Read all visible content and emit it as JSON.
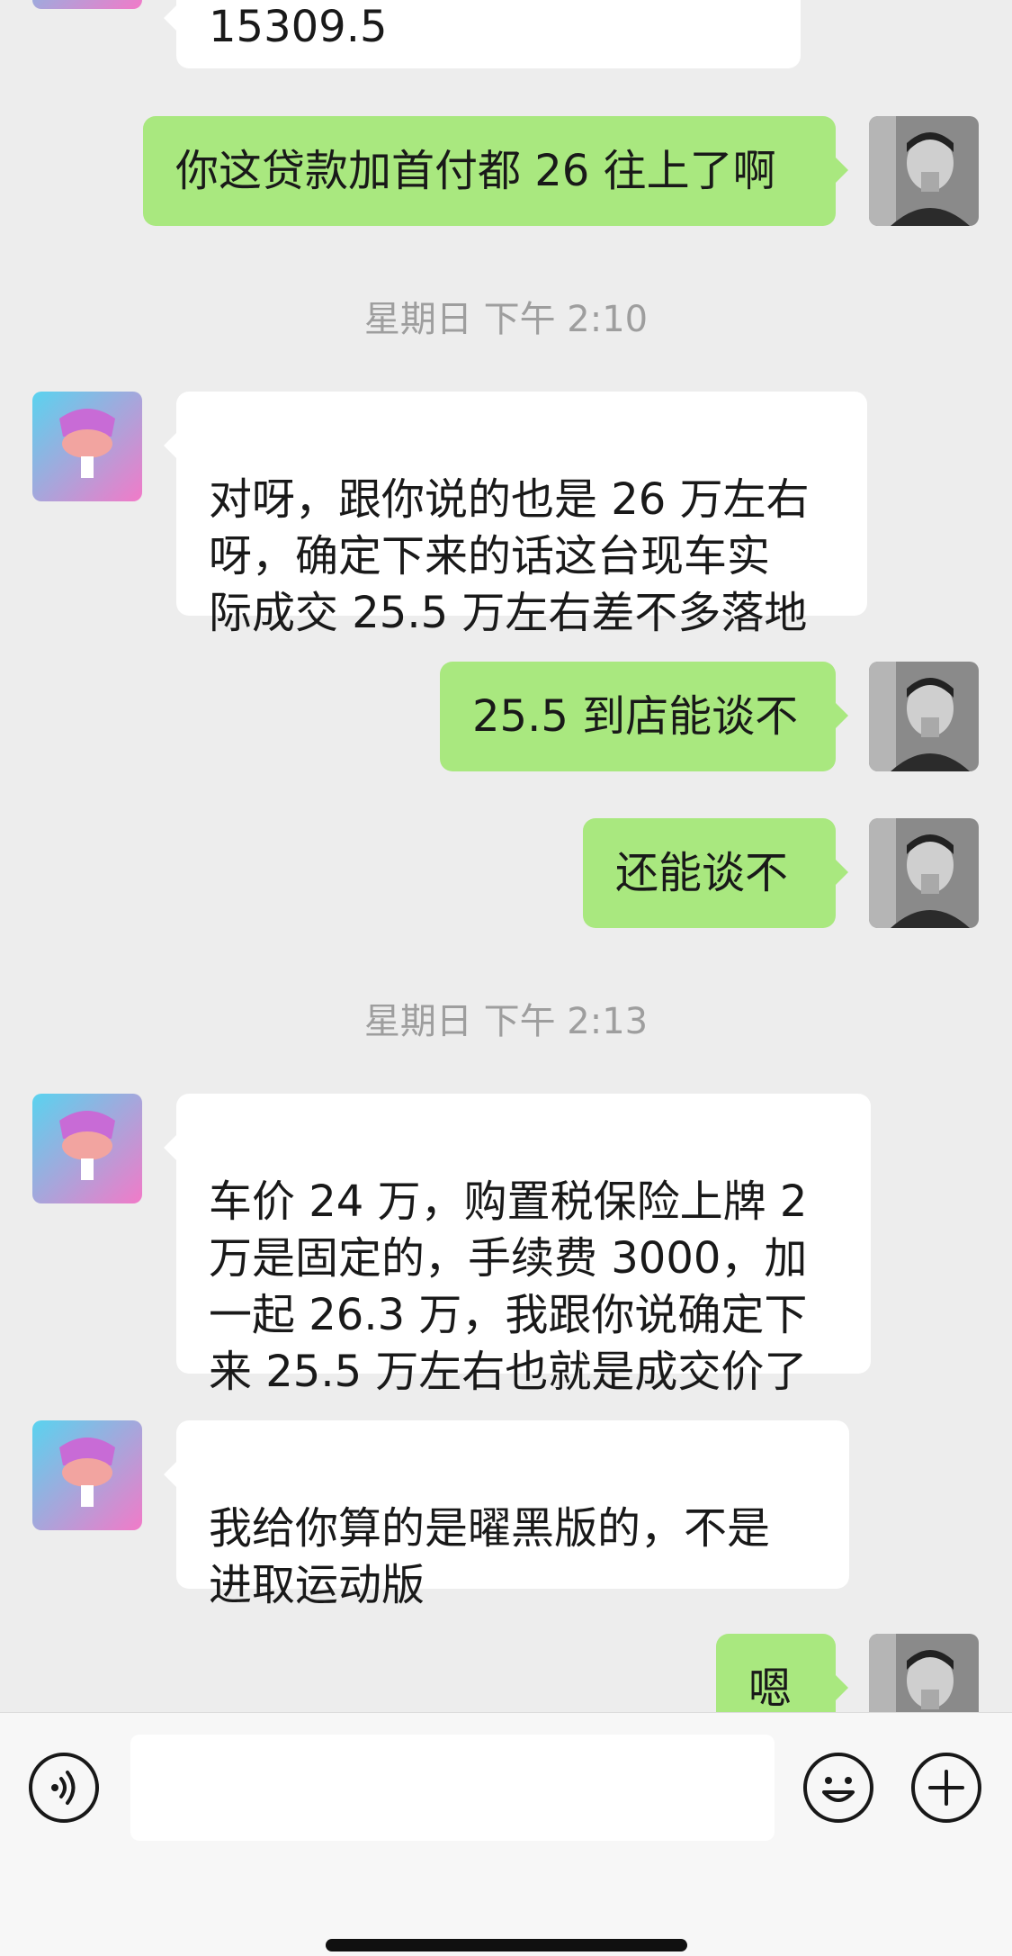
{
  "conversation": {
    "partial_top_message": "15309.5",
    "msg_out_1": "你这贷款加首付都 26 往上了啊",
    "timestamp_1": "星期日 下午 2:10",
    "msg_in_1": "对呀，跟你说的也是 26 万左右\n呀，确定下来的话这台现车实\n际成交 25.5 万左右差不多落地",
    "msg_out_2": "25.5 到店能谈不",
    "msg_out_3": "还能谈不",
    "timestamp_2": "星期日 下午 2:13",
    "msg_in_2": "车价 24 万，购置税保险上牌 2\n万是固定的，手续费 3000，加\n一起 26.3 万，我跟你说确定下\n来 25.5 万左右也就是成交价了",
    "msg_in_3": "我给你算的是曜黑版的，不是\n进取运动版",
    "msg_out_4": "嗯"
  },
  "input_bar": {
    "placeholder": "",
    "voice_icon": "voice-icon",
    "emoji_icon": "emoji-icon",
    "plus_icon": "plus-icon"
  },
  "colors": {
    "background": "#ededed",
    "outgoing_bubble": "#a9e87f",
    "incoming_bubble": "#ffffff",
    "timestamp_text": "#9e9e9e"
  }
}
